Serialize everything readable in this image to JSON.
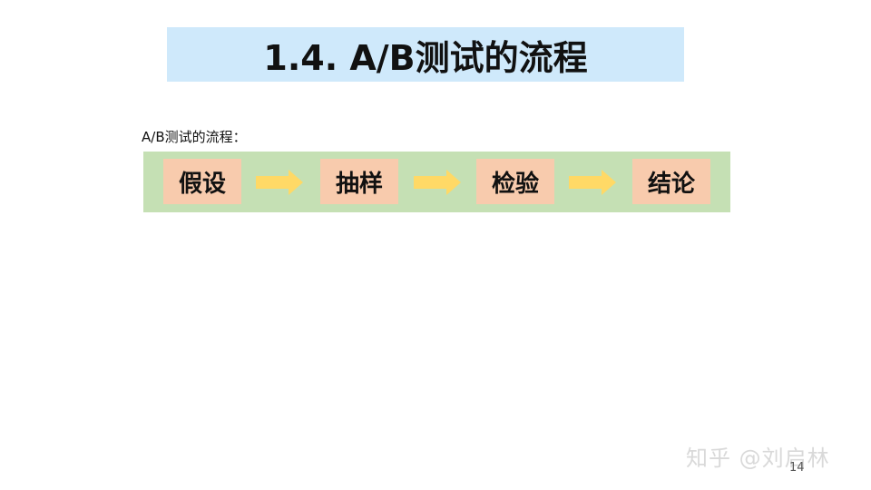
{
  "slide": {
    "title": "1.4. A/B测试的流程",
    "subtitle": "A/B测试的流程：",
    "steps": [
      "假设",
      "抽样",
      "检验",
      "结论"
    ],
    "arrow_icon": "right-arrow-icon",
    "page_number": "14",
    "watermark": "知乎 @刘启林"
  },
  "colors": {
    "title_background": "#cfe9fb",
    "flow_band": "#c5e0b4",
    "step_box": "#f8cbad",
    "arrow": "#ffd966"
  }
}
